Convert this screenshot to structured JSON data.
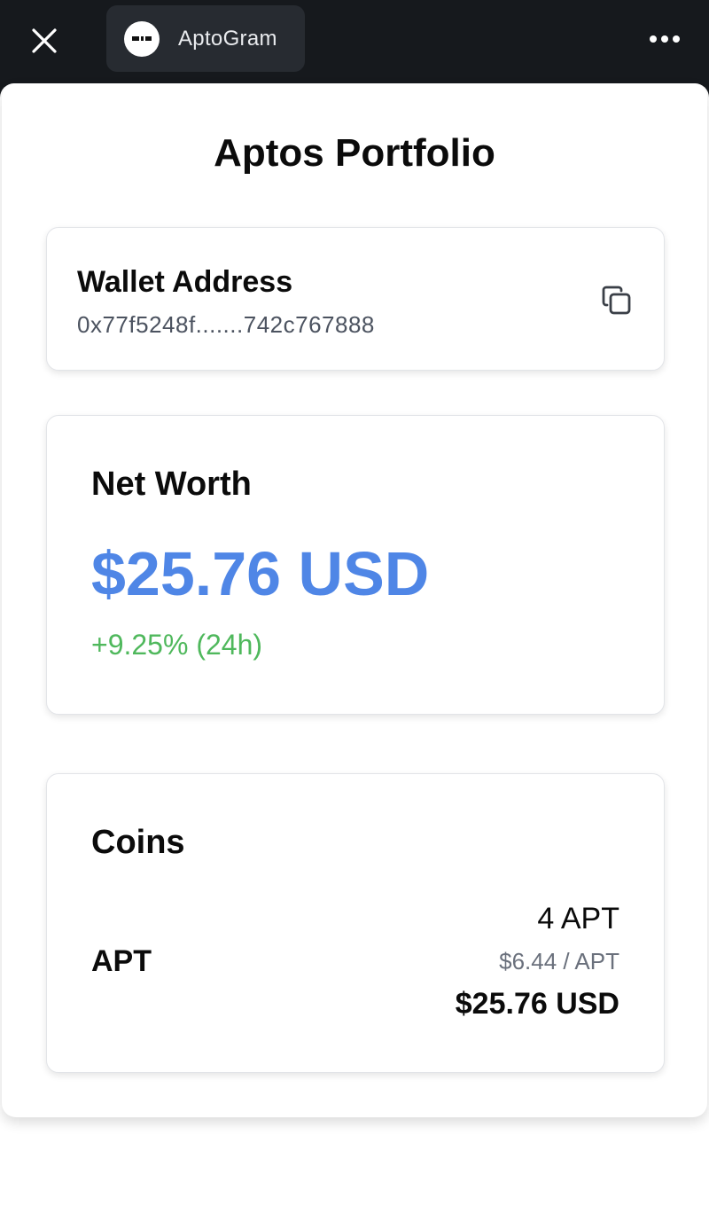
{
  "topbar": {
    "app_name": "AptoGram",
    "close_icon": "close-icon",
    "more_icon": "more-horizontal-icon"
  },
  "page": {
    "title": "Aptos Portfolio"
  },
  "wallet": {
    "label": "Wallet Address",
    "address": "0x77f5248f.......742c767888",
    "copy_icon": "copy-icon"
  },
  "net_worth": {
    "label": "Net Worth",
    "value": "$25.76 USD",
    "change": "+9.25% (24h)"
  },
  "coins": {
    "label": "Coins",
    "items": [
      {
        "symbol": "APT",
        "amount": "4 APT",
        "price": "$6.44 / APT",
        "value": "$25.76 USD"
      }
    ]
  },
  "colors": {
    "accent_blue": "#4f86e6",
    "positive_green": "#4fb85c",
    "topbar_bg": "#16191d"
  }
}
